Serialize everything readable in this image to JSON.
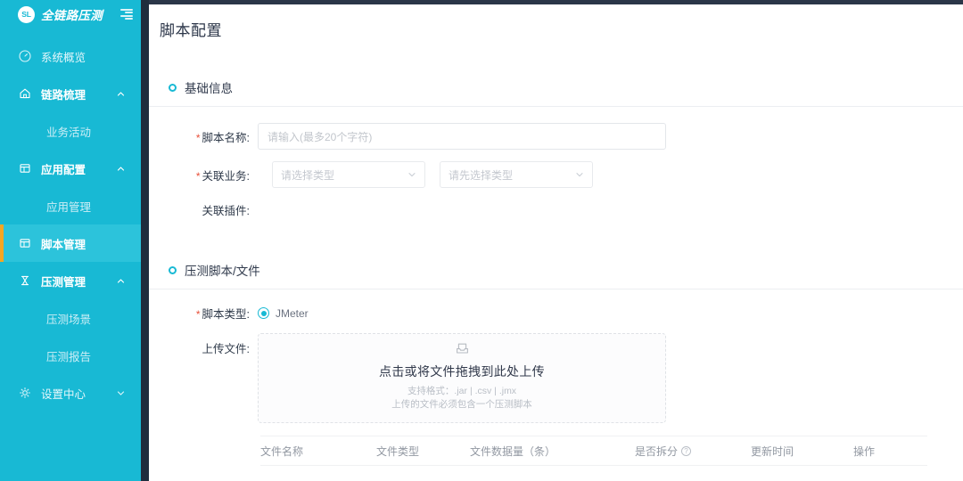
{
  "brand": {
    "badge": "SL",
    "name": "全链路压测",
    "menu_icon": "menu-fold-icon",
    "accent_cyan": "#18b9d4",
    "accent_orange": "#f5a623"
  },
  "sidebar": {
    "items": [
      {
        "label": "系统概览",
        "icon": "dashboard-icon",
        "type": "item",
        "active": false
      },
      {
        "label": "链路梳理",
        "icon": "home-icon",
        "type": "group",
        "caret": "chevron-up-icon",
        "expanded": true
      },
      {
        "label": "业务活动",
        "icon": "",
        "type": "sub",
        "active": false
      },
      {
        "label": "应用配置",
        "icon": "database-icon",
        "type": "group",
        "caret": "chevron-up-icon",
        "expanded": true
      },
      {
        "label": "应用管理",
        "icon": "",
        "type": "sub",
        "active": false
      },
      {
        "label": "脚本管理",
        "icon": "database-icon",
        "type": "item",
        "active": true
      },
      {
        "label": "压测管理",
        "icon": "hourglass-icon",
        "type": "group",
        "caret": "chevron-up-icon",
        "expanded": true
      },
      {
        "label": "压测场景",
        "icon": "",
        "type": "sub",
        "active": false
      },
      {
        "label": "压测报告",
        "icon": "",
        "type": "sub",
        "active": false
      },
      {
        "label": "设置中心",
        "icon": "gear-icon",
        "type": "group",
        "caret": "chevron-down-icon",
        "expanded": false
      }
    ]
  },
  "page": {
    "title": "脚本配置"
  },
  "basic_section": {
    "heading": "基础信息",
    "script_name_label": "脚本名称:",
    "script_name_placeholder": "请输入(最多20个字符)",
    "script_name_value": "",
    "related_business_label": "关联业务:",
    "select_one_placeholder": "请选择类型",
    "select_two_placeholder": "请先选择类型",
    "related_plugin_label": "关联插件:",
    "required_mark": "*"
  },
  "script_section": {
    "heading": "压测脚本/文件",
    "script_type_label": "脚本类型:",
    "script_type_option": "JMeter",
    "upload_label": "上传文件:",
    "dropzone": {
      "icon": "inbox-upload-icon",
      "main_text": "点击或将文件拖拽到此处上传",
      "hint_format": "支持格式：.jar | .csv | .jmx",
      "hint_requirement": "上传的文件必须包含一个压测脚本"
    },
    "table_headers": [
      {
        "label": "文件名称",
        "icon": ""
      },
      {
        "label": "文件类型",
        "icon": ""
      },
      {
        "label": "文件数据量（条）",
        "icon": ""
      },
      {
        "label": "是否拆分",
        "icon": "question-circle-icon"
      },
      {
        "label": "更新时间",
        "icon": ""
      },
      {
        "label": "操作",
        "icon": ""
      }
    ]
  }
}
